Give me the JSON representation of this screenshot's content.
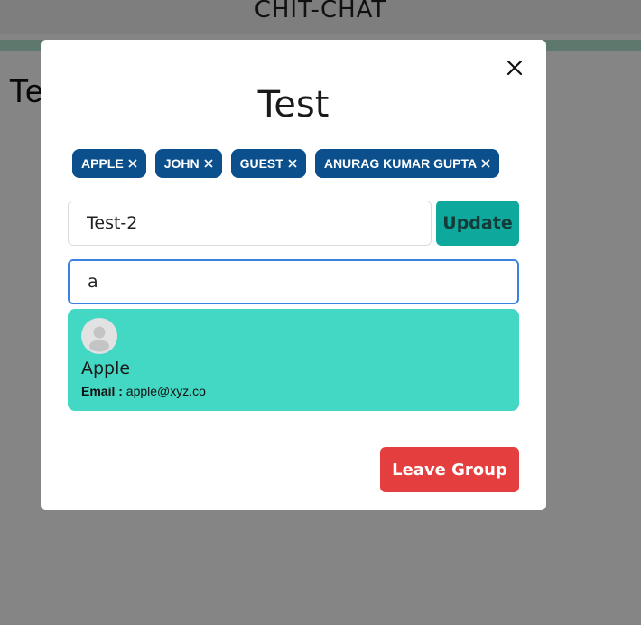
{
  "app": {
    "title": "CHIT-CHAT",
    "chat_title": "Test"
  },
  "modal": {
    "title": "Test",
    "close_icon": "close-icon",
    "members": [
      {
        "label": "APPLE"
      },
      {
        "label": "JOHN"
      },
      {
        "label": "GUEST"
      },
      {
        "label": "ANURAG KUMAR GUPTA"
      }
    ],
    "rename": {
      "value": "Test-2",
      "button_label": "Update"
    },
    "search": {
      "value": "a"
    },
    "results": [
      {
        "name": "Apple",
        "email_label": "Email :",
        "email": "apple@xyz.co"
      }
    ],
    "leave_button_label": "Leave Group"
  },
  "colors": {
    "chip": "#0b4f8c",
    "update_button": "#0ea89c",
    "result_card": "#43d8c3",
    "leave_button": "#e53e3e",
    "search_border": "#3b82e0"
  }
}
